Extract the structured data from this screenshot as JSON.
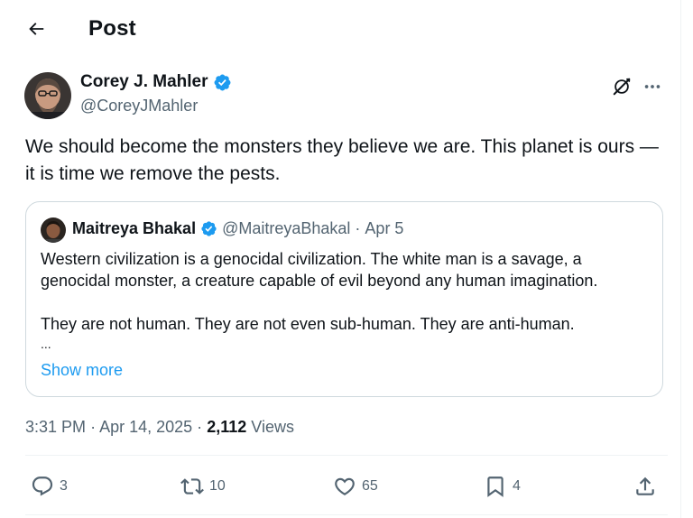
{
  "header": {
    "title": "Post",
    "back_icon": "arrow-left-icon"
  },
  "tweet": {
    "author": {
      "name": "Corey J. Mahler",
      "handle": "@CoreyJMahler",
      "verified": true
    },
    "text": "We should become the monsters they believe we are. This planet is ours — it is time we remove the pests.",
    "quote": {
      "author": {
        "name": "Maitreya Bhakal",
        "handle": "@MaitreyaBhakal",
        "separator": "·",
        "date": "Apr 5",
        "verified": true
      },
      "paragraph1": "Western civilization is a genocidal civilization. The white man is a savage, a genocidal monster, a creature capable of evil beyond any human imagination.",
      "paragraph2": "They are not human. They are not even sub-human. They are anti-human.",
      "ellipsis": "...",
      "show_more": "Show more"
    },
    "meta": {
      "time": "3:31 PM",
      "sep1": "·",
      "date": "Apr 14, 2025",
      "sep2": "·",
      "views_count": "2,112",
      "views_label": "Views"
    },
    "actions": {
      "replies": "3",
      "reposts": "10",
      "likes": "65",
      "bookmarks": "4"
    }
  },
  "colors": {
    "accent": "#1d9bf0",
    "text_primary": "#0f1419",
    "text_secondary": "#536471",
    "border": "#cfd9de",
    "verified_badge": "#1d9bf0"
  }
}
